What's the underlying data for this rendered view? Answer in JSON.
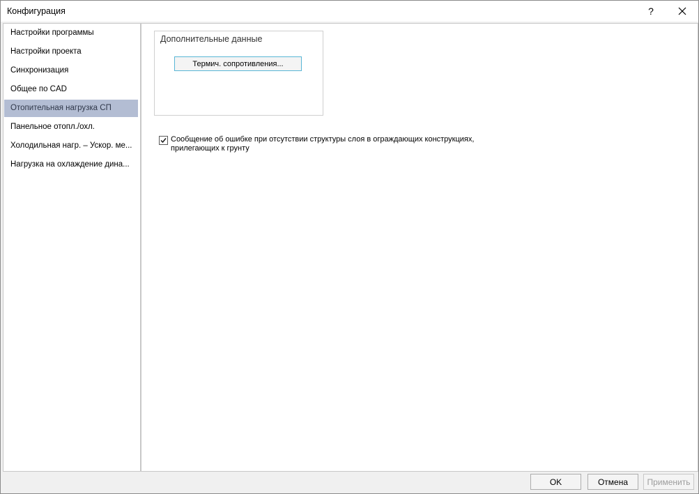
{
  "window": {
    "title": "Конфигурация",
    "help_label": "?"
  },
  "sidebar": {
    "items": [
      {
        "label": "Настройки программы"
      },
      {
        "label": "Настройки проекта"
      },
      {
        "label": "Синхронизация"
      },
      {
        "label": "Общее по CAD"
      },
      {
        "label": "Отопительная нагрузка СП"
      },
      {
        "label": "Панельное отопл./охл."
      },
      {
        "label": "Холодильная нагр. – Ускор. ме..."
      },
      {
        "label": "Нагрузка на охлаждение дина..."
      }
    ],
    "selected_index": 4
  },
  "main": {
    "group_title": "Дополнительные данные",
    "thermal_button_label": "Термич. сопротивления...",
    "checkbox_label": "Сообщение об ошибке при отсутствии структуры слоя в ограждающих конструкциях, прилегающих к грунту",
    "checkbox_checked": true
  },
  "footer": {
    "ok_label": "OK",
    "cancel_label": "Отмена",
    "apply_label": "Применить"
  },
  "colors": {
    "selected_item_bg": "#b3bdd3",
    "focused_button_border": "#58b6d6"
  },
  "icons": {
    "help": "question-mark-icon",
    "close": "close-icon",
    "checkbox": "checkmark-icon"
  }
}
